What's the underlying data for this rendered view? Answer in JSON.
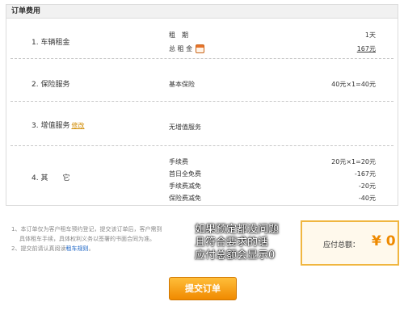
{
  "panel": {
    "title": "订单费用"
  },
  "rows": {
    "rental": {
      "title": "1. 车辆租金",
      "details": [
        {
          "key": "租　期",
          "value": "1天"
        },
        {
          "key": "总 租 金",
          "value": "167元"
        }
      ]
    },
    "insurance": {
      "title": "2. 保险服务",
      "details": [
        {
          "key": "基本保险",
          "value": "40元×1=40元"
        }
      ]
    },
    "value_added": {
      "title": "3. 增值服务",
      "edit_label": "修改",
      "details": [
        {
          "key": "无增值服务",
          "value": ""
        }
      ]
    },
    "other": {
      "title": "4. 其　　它",
      "details": [
        {
          "key": "手续费",
          "value": "20元×1=20元"
        },
        {
          "key": "首日全免费",
          "value": "-167元"
        },
        {
          "key": "手续费减免",
          "value": "-20元"
        },
        {
          "key": "保险费减免",
          "value": "-40元"
        }
      ]
    }
  },
  "notes": {
    "line1": "1、本订单仅为客户租车预约登记，提交该订单后，客户需到",
    "line2": "具体租车手续，具体权利义务以签署的书面合同为准。",
    "line3_prefix": "2、提交前请认真阅读",
    "line3_link": "租车规则",
    "line3_suffix": "。"
  },
  "overlay": {
    "line1": "如果预定都没问题",
    "line2": "且符合要求的话",
    "line3": "应付总额会显示0"
  },
  "total": {
    "label": "应付总额：",
    "amount": "¥ 0"
  },
  "submit": {
    "label": "提交订单"
  },
  "colors": {
    "accent": "#ee8a00",
    "button": "#f5a623",
    "link": "#1a63c4"
  }
}
